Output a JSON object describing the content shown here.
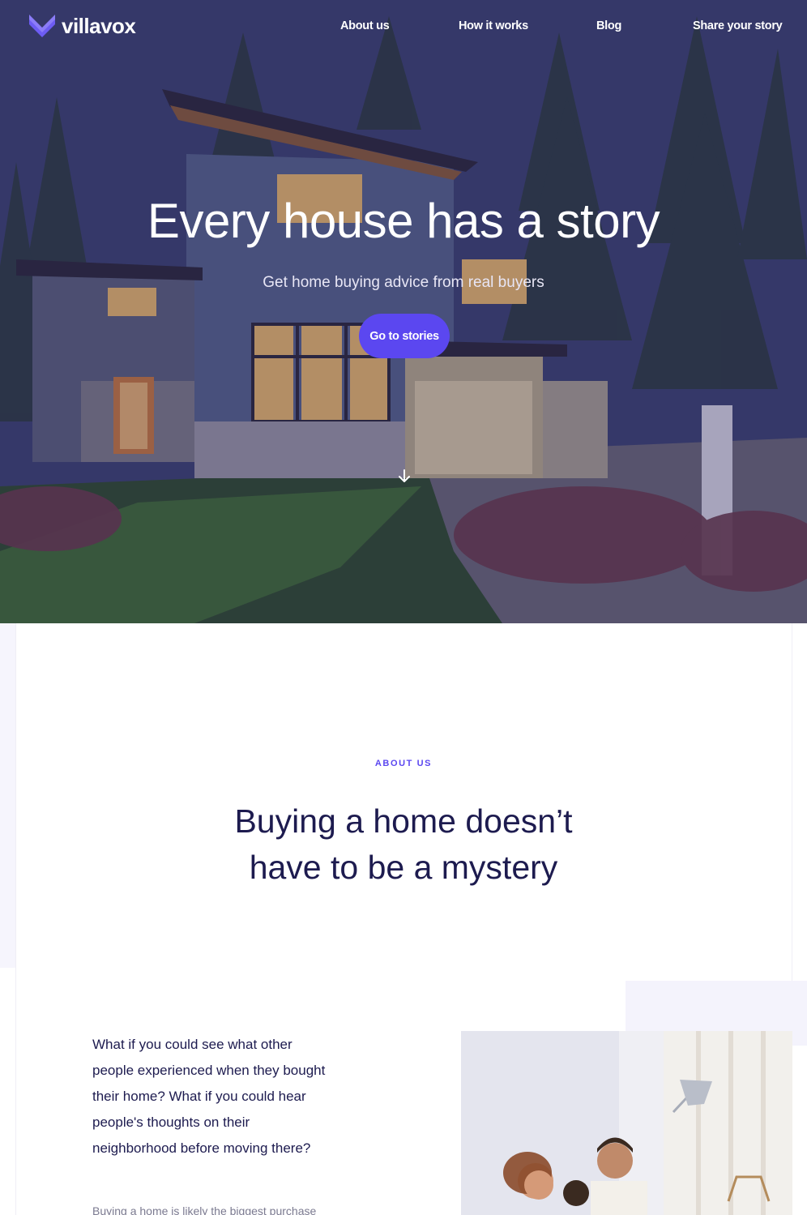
{
  "brand": {
    "name": "villavox",
    "accent": "#5b47f0",
    "dark_text": "#1d1b4f"
  },
  "nav": {
    "items": [
      {
        "label": "About us"
      },
      {
        "label": "How it works"
      },
      {
        "label": "Blog"
      },
      {
        "label": "Share your story"
      }
    ]
  },
  "hero": {
    "title": "Every house has a story",
    "subtitle": "Get home buying advice from real buyers",
    "cta_label": "Go to stories",
    "scroll_icon": "arrow-down-icon",
    "background_image": "modern-house-at-dusk"
  },
  "about": {
    "eyebrow": "ABOUT US",
    "title_line1": "Buying a home doesn’t",
    "title_line2": "have to be a mystery",
    "lead": "What if you could see what other people experienced when they bought their home? What if you could hear people's thoughts on their neighborhood before moving there?",
    "body": "Buying a home is likely the biggest purchase",
    "image": "family-at-home-photo"
  }
}
